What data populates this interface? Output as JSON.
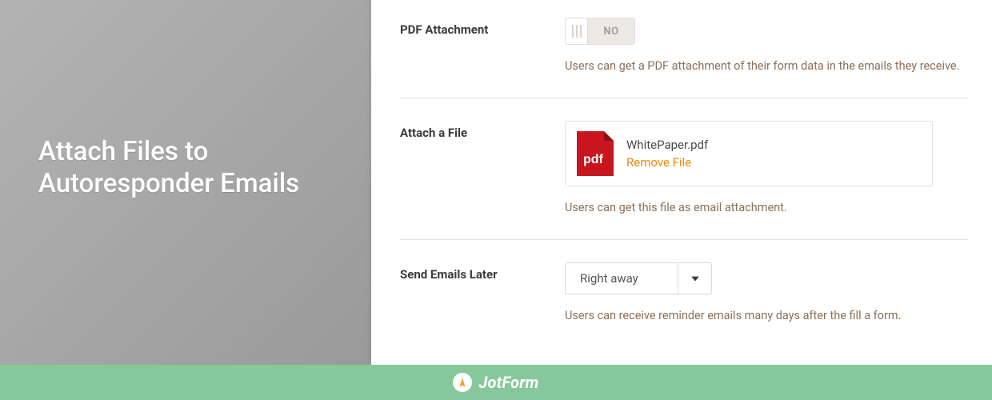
{
  "left": {
    "title": "Attach Files to Autoresponder Emails"
  },
  "sections": {
    "pdf": {
      "label": "PDF Attachment",
      "toggle_state": "NO",
      "helper": "Users can get a PDF attachment of their form data in the emails they receive."
    },
    "attach": {
      "label": "Attach a File",
      "file_name": "WhitePaper.pdf",
      "file_icon_text": "pdf",
      "remove_label": "Remove File",
      "helper": "Users can get this file as email attachment."
    },
    "later": {
      "label": "Send Emails Later",
      "selected": "Right away",
      "helper": "Users can receive reminder emails many days after the fill a form."
    }
  },
  "footer": {
    "brand": "JotForm"
  },
  "colors": {
    "accent": "#f2870a",
    "footer": "#86c79b",
    "pdf_red": "#c9151e"
  }
}
